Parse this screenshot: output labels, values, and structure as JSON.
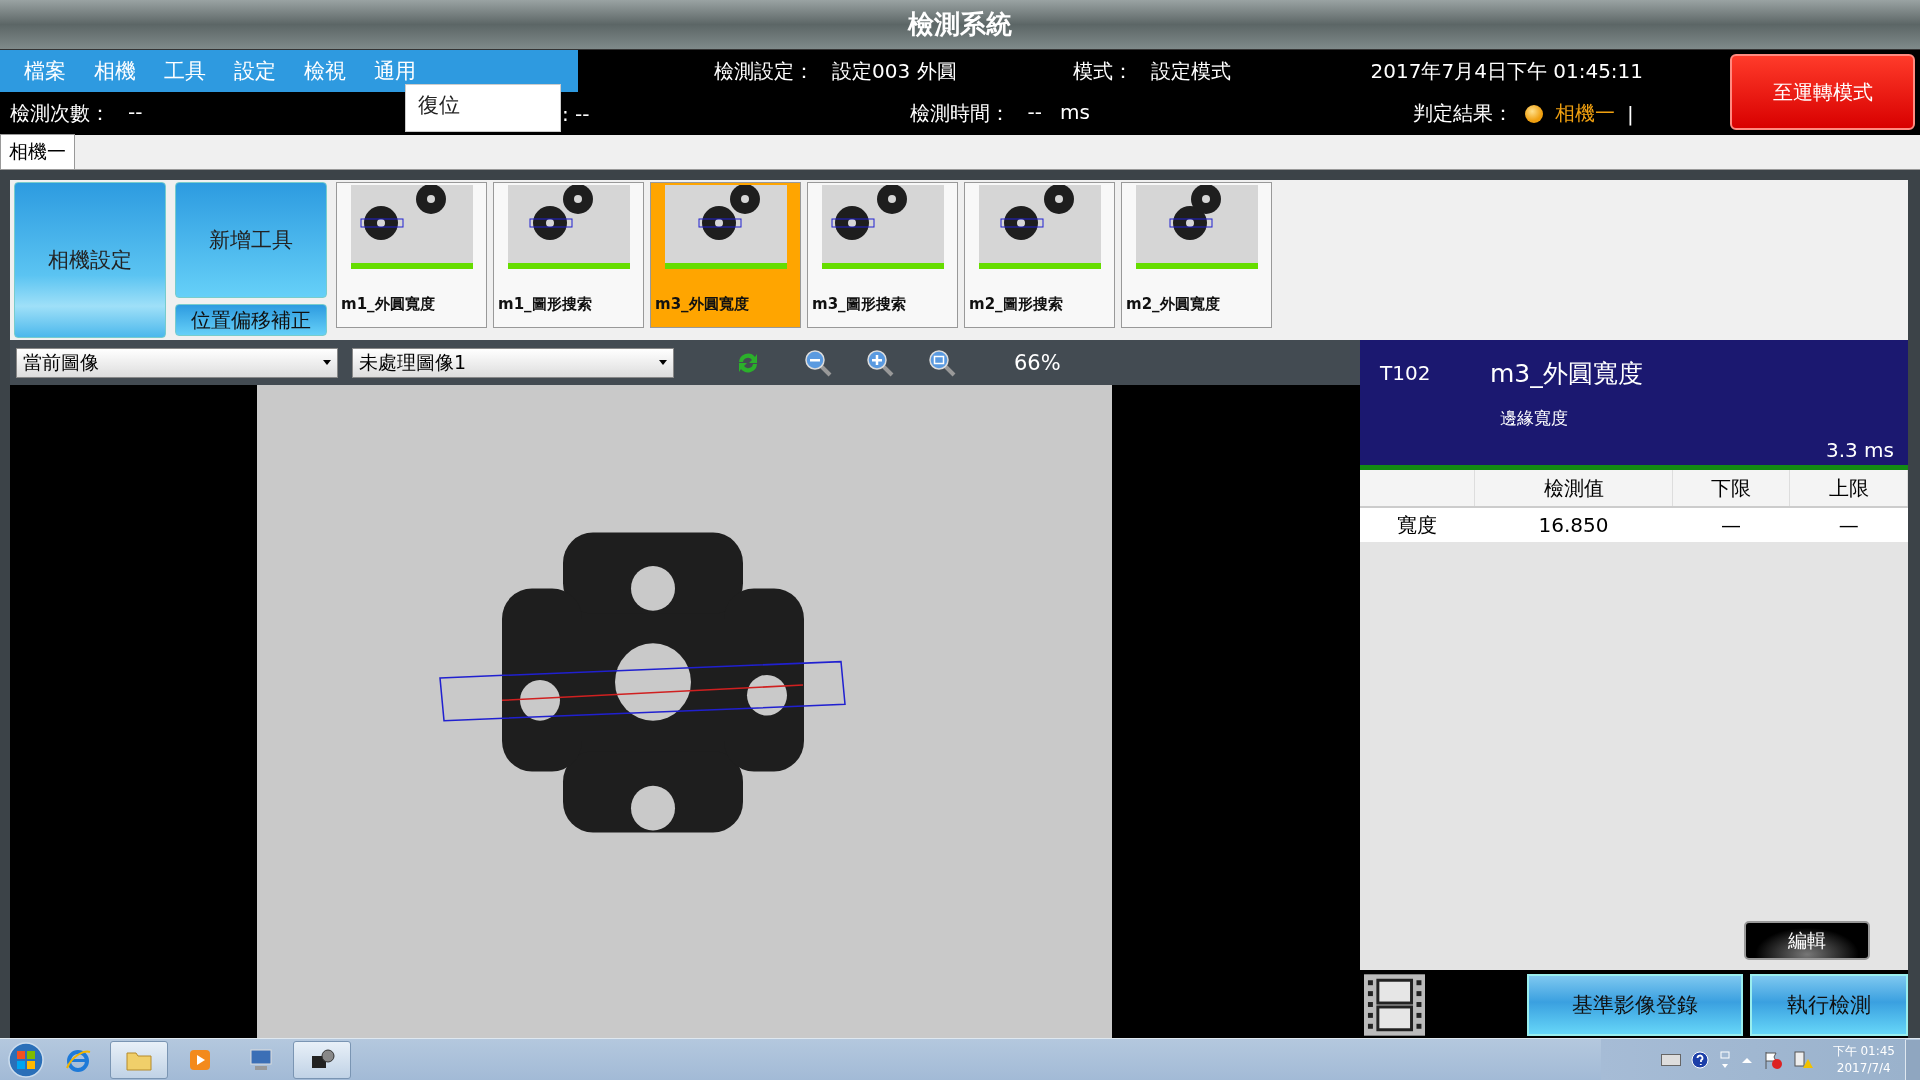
{
  "window": {
    "title": "檢測系統"
  },
  "menu": [
    {
      "label": "檔案"
    },
    {
      "label": "相機"
    },
    {
      "label": "工具"
    },
    {
      "label": "設定"
    },
    {
      "label": "檢視"
    },
    {
      "label": "通用"
    }
  ],
  "open_menu": {
    "items": [
      {
        "label": "復位"
      }
    ]
  },
  "header": {
    "setting_label": "檢測設定：",
    "setting_value": "設定003 外圓",
    "mode_label": "模式：",
    "mode_value": "設定模式",
    "datetime": "2017年7月4日下午 01:45:11"
  },
  "run_mode_button": "至運轉模式",
  "status": {
    "count_label": "檢測次數：",
    "count_value": "--",
    "hidden_value": ": --",
    "time_label": "檢測時間：",
    "time_value": "--",
    "time_unit": "ms",
    "result_label": "判定結果：",
    "result_camera": "相機一",
    "cursor": "|"
  },
  "tabs": [
    {
      "label": "相機一",
      "selected": true
    }
  ],
  "side_buttons": [
    "相機設定",
    "新增工具",
    "位置偏移補正"
  ],
  "tools": [
    {
      "label": "m1_外圓寬度",
      "selected": false
    },
    {
      "label": "m1_圖形搜索",
      "selected": false
    },
    {
      "label": "m3_外圓寬度",
      "selected": true
    },
    {
      "label": "m3_圖形搜索",
      "selected": false
    },
    {
      "label": "m2_圖形搜索",
      "selected": false
    },
    {
      "label": "m2_外圓寬度",
      "selected": false
    }
  ],
  "toolbar": {
    "dropdowns": [
      {
        "value": "當前圖像"
      },
      {
        "value": "未處理圖像1"
      }
    ],
    "zoom": "66%"
  },
  "detail": {
    "id": "T102",
    "name": "m3_外圓寬度",
    "type": "邊緣寬度",
    "time": "3.3 ms",
    "columns": [
      "檢測值",
      "下限",
      "上限"
    ],
    "rows": [
      {
        "name": "寬度",
        "cells": [
          "16.850",
          "—",
          "—"
        ]
      }
    ]
  },
  "edit_button": "編輯",
  "bottom_buttons": [
    "基準影像登錄",
    "執行檢測"
  ],
  "taskbar": {
    "apps": [
      {
        "kind": "ie",
        "active": false
      },
      {
        "kind": "folder",
        "active": true
      },
      {
        "kind": "media",
        "active": false
      },
      {
        "kind": "computer",
        "active": false
      },
      {
        "kind": "camera",
        "active": true
      }
    ],
    "time": "下午 01:45",
    "date": "2017/7/4"
  }
}
